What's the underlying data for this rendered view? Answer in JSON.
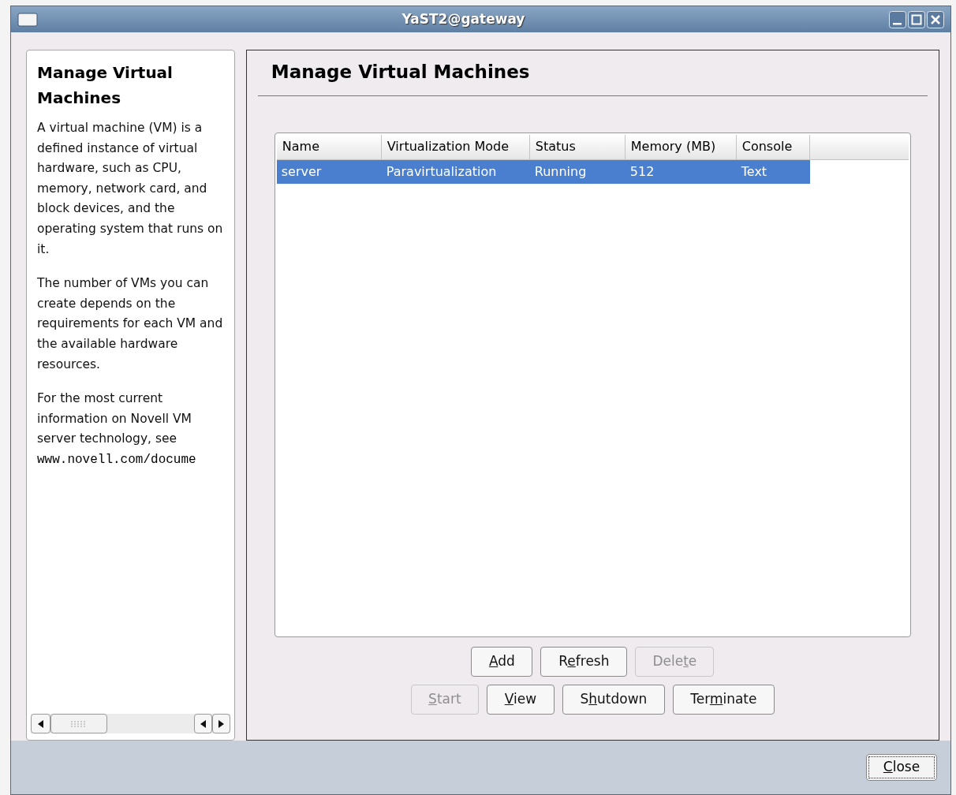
{
  "window": {
    "title": "YaST2@gateway"
  },
  "help": {
    "title": "Manage Virtual Machines",
    "paragraphs": [
      "A virtual machine (VM) is a defined instance of virtual hardware, such as CPU, memory, network card, and block devices, and the operating system that runs on it.",
      "The number of VMs you can create depends on the requirements for each VM and the available hardware resources.",
      "For the most current information on Novell VM server technology, see"
    ],
    "link": "www.novell.com/docume"
  },
  "main": {
    "title": "Manage Virtual Machines"
  },
  "table": {
    "columns": [
      "Name",
      "Virtualization Mode",
      "Status",
      "Memory (MB)",
      "Console"
    ],
    "rows": [
      {
        "cells": [
          "server",
          "Paravirtualization",
          "Running",
          "512",
          "Text"
        ],
        "selected": true
      }
    ]
  },
  "button_rows": [
    [
      {
        "key": "A",
        "after": "dd",
        "disabled": false
      },
      {
        "before": "R",
        "key": "e",
        "after": "fresh",
        "disabled": false
      },
      {
        "before": "Dele",
        "key": "t",
        "after": "e",
        "disabled": true
      }
    ],
    [
      {
        "key": "S",
        "after": "tart",
        "disabled": true
      },
      {
        "key": "V",
        "after": "iew",
        "disabled": false
      },
      {
        "before": "S",
        "key": "h",
        "after": "utdown",
        "disabled": false
      },
      {
        "before": "Ter",
        "key": "m",
        "after": "inate",
        "disabled": false
      }
    ]
  ],
  "close_button": {
    "key": "C",
    "after": "lose"
  }
}
